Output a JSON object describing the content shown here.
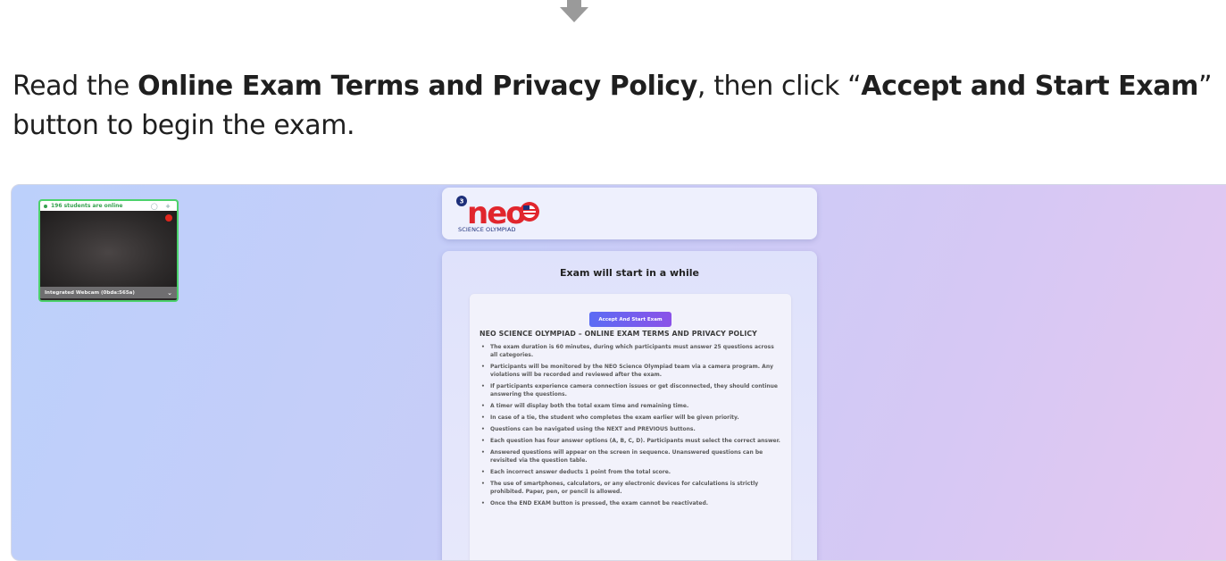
{
  "instruction": {
    "part1": "Read the ",
    "bold1": "Online Exam Terms and Privacy Policy",
    "part2": ", then click “",
    "bold2": "Accept and Start Exam",
    "part3": "” button to begin the exam."
  },
  "webcam": {
    "status": "196 students are online",
    "controls": "◯ +",
    "device": "Integrated Webcam (0bda:565a)"
  },
  "logo": {
    "badge": "3",
    "wordmark": "neo",
    "subtitle": "SCIENCE OLYMPIAD"
  },
  "exam": {
    "heading": "Exam will start in a while",
    "accept_button": "Accept And Start Exam",
    "policy_title": "NEO SCIENCE OLYMPIAD – ONLINE EXAM TERMS AND PRIVACY POLICY",
    "rules": [
      "The exam duration is 60 minutes, during which participants must answer 25 questions across all categories.",
      "Participants will be monitored by the NEO Science Olympiad team via a camera program. Any violations will be recorded and reviewed after the exam.",
      "If participants experience camera connection issues or get disconnected, they should continue answering the questions.",
      "A timer will display both the total exam time and remaining time.",
      "In case of a tie, the student who completes the exam earlier will be given priority.",
      "Questions can be navigated using the NEXT and PREVIOUS buttons.",
      "Each question has four answer options (A, B, C, D). Participants must select the correct answer.",
      "Answered questions will appear on the screen in sequence. Unanswered questions can be revisited via the question table.",
      "Each incorrect answer deducts 1 point from the total score.",
      "The use of smartphones, calculators, or any electronic devices for calculations is strictly prohibited. Paper, pen, or pencil is allowed.",
      "Once the END EXAM button is pressed, the exam cannot be reactivated."
    ]
  },
  "colors": {
    "accent_start": "#5b6cf4",
    "accent_end": "#8b52e8",
    "webcam_border": "#4cd26b",
    "recording": "#e0261d",
    "logo_red": "#e1262d",
    "logo_navy": "#1d2f7a"
  }
}
